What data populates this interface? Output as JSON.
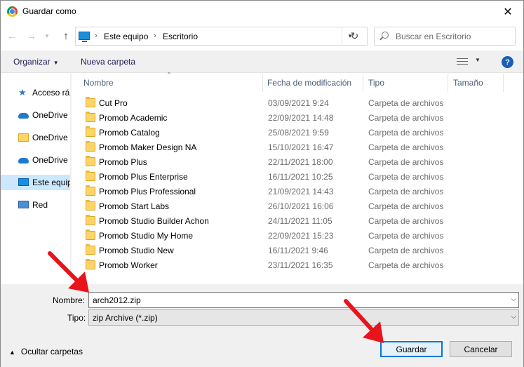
{
  "window": {
    "title": "Guardar como"
  },
  "address": {
    "crumbs": [
      "Este equipo",
      "Escritorio"
    ]
  },
  "search": {
    "placeholder": "Buscar en Escritorio"
  },
  "toolbar": {
    "organize": "Organizar",
    "new_folder": "Nueva carpeta",
    "help": "?"
  },
  "sidebar": {
    "items": [
      {
        "label": "Acceso rá",
        "icon": "star-icon"
      },
      {
        "label": "OneDrive",
        "icon": "cloud-icon"
      },
      {
        "label": "OneDrive",
        "icon": "folder-icon"
      },
      {
        "label": "OneDrive",
        "icon": "cloud-icon"
      },
      {
        "label": "Este equipo",
        "icon": "computer-icon"
      },
      {
        "label": "Red",
        "icon": "network-icon"
      }
    ]
  },
  "columns": {
    "name": "Nombre",
    "date": "Fecha de modificación",
    "type": "Tipo",
    "size": "Tamaño"
  },
  "files": [
    {
      "name": "Cut Pro",
      "date": "03/09/2021 9:24",
      "type": "Carpeta de archivos"
    },
    {
      "name": "Promob Academic",
      "date": "22/09/2021 14:48",
      "type": "Carpeta de archivos"
    },
    {
      "name": "Promob Catalog",
      "date": "25/08/2021 9:59",
      "type": "Carpeta de archivos"
    },
    {
      "name": "Promob Maker Design NA",
      "date": "15/10/2021 16:47",
      "type": "Carpeta de archivos"
    },
    {
      "name": "Promob Plus",
      "date": "22/11/2021 18:00",
      "type": "Carpeta de archivos"
    },
    {
      "name": "Promob Plus Enterprise",
      "date": "16/11/2021 10:25",
      "type": "Carpeta de archivos"
    },
    {
      "name": "Promob Plus Professional",
      "date": "21/09/2021 14:43",
      "type": "Carpeta de archivos"
    },
    {
      "name": "Promob Start Labs",
      "date": "26/10/2021 16:06",
      "type": "Carpeta de archivos"
    },
    {
      "name": "Promob Studio Builder Achon",
      "date": "24/11/2021 11:05",
      "type": "Carpeta de archivos"
    },
    {
      "name": "Promob Studio My Home",
      "date": "22/09/2021 15:23",
      "type": "Carpeta de archivos"
    },
    {
      "name": "Promob Studio New",
      "date": "16/11/2021 9:46",
      "type": "Carpeta de archivos"
    },
    {
      "name": "Promob Worker",
      "date": "23/11/2021 16:35",
      "type": "Carpeta de archivos"
    }
  ],
  "form": {
    "name_label": "Nombre:",
    "name_value": "arch2012.zip",
    "type_label": "Tipo:",
    "type_value": "zip Archive (*.zip)",
    "hide_folders": "Ocultar carpetas",
    "save": "Guardar",
    "cancel": "Cancelar"
  },
  "colors": {
    "accent": "#0078d7",
    "selection": "#cce8ff",
    "annotation_arrow": "#e8141c"
  }
}
